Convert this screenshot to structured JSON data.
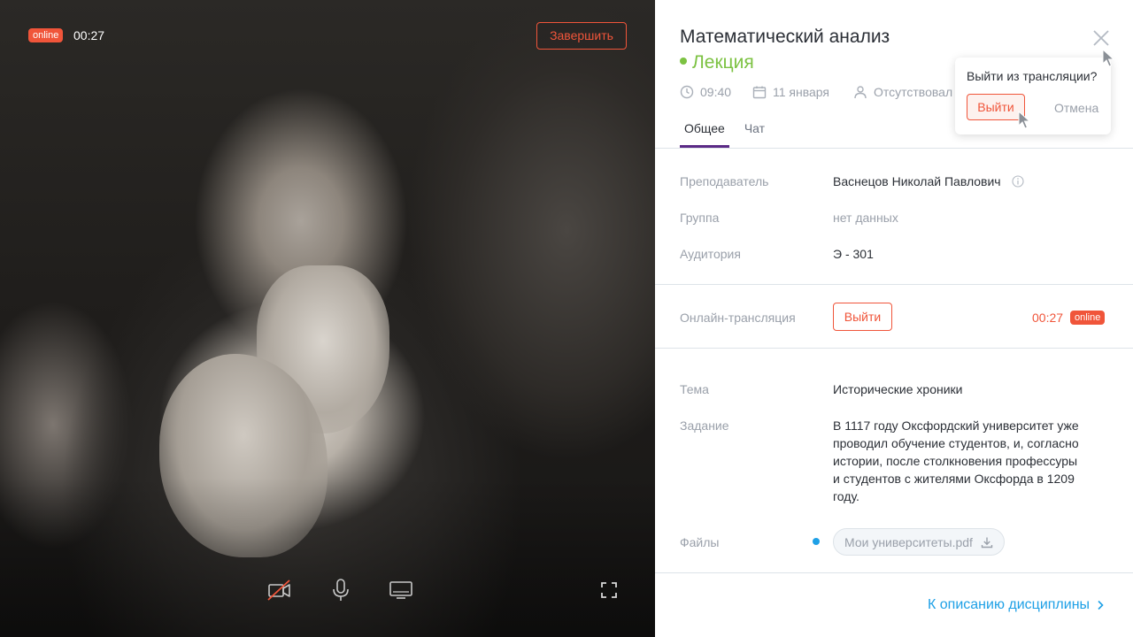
{
  "video": {
    "live_badge": "online",
    "live_time": "00:27",
    "end_button": "Завершить",
    "controls": [
      "camera-off-icon",
      "microphone-icon",
      "screen-share-icon",
      "fullscreen-icon"
    ]
  },
  "panel": {
    "title": "Математический анализ",
    "type": "Лекция",
    "meta": {
      "time": "09:40",
      "date": "11 января",
      "attendance": "Отсутствовал"
    },
    "tabs": [
      "Общее",
      "Чат"
    ],
    "active_tab": "Общее",
    "details": {
      "teacher_label": "Преподаватель",
      "teacher_value": "Васнецов Николай Павлович",
      "group_label": "Группа",
      "group_value": "нет данных",
      "room_label": "Аудитория",
      "room_value": "Э - 301"
    },
    "stream": {
      "label": "Онлайн-трансляция",
      "leave_button": "Выйти",
      "time": "00:27",
      "badge": "online"
    },
    "topic": {
      "topic_label": "Тема",
      "topic_value": "Исторические хроники",
      "task_label": "Задание",
      "task_value": "В 1117 году Оксфордский университет уже проводил обучение студентов, и, согласно истории, после столкновения профессуры и студентов с жителями Оксфорда в 1209 году.",
      "files_label": "Файлы",
      "file_name": "Мои университеты.pdf"
    },
    "footer_link": "К описанию дисциплины"
  },
  "popover": {
    "question": "Выйти из трансляции?",
    "confirm": "Выйти",
    "cancel": "Отмена"
  },
  "colors": {
    "accent_red": "#f0553a",
    "accent_green": "#7cc242",
    "accent_blue": "#1ea0e6",
    "tab_underline": "#5b2a86"
  }
}
